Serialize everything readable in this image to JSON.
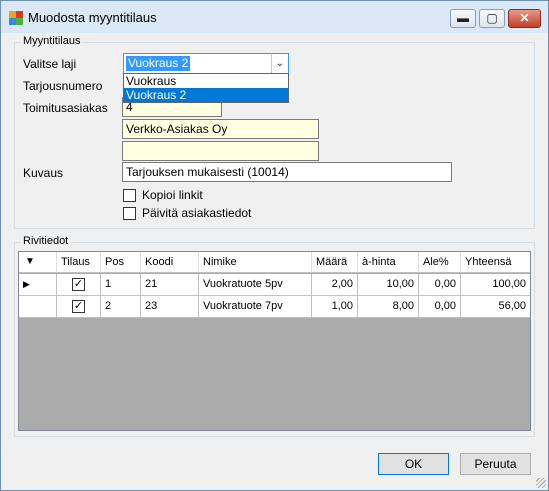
{
  "window": {
    "title": "Muodosta myyntitilaus",
    "minimize_glyph": "▬",
    "maximize_glyph": "▢",
    "close_glyph": "✕"
  },
  "sales_group": {
    "legend": "Myyntitilaus",
    "type_label": "Valitse laji",
    "type_selected": "Vuokraus 2",
    "type_options": [
      "Vuokraus",
      "Vuokraus 2"
    ],
    "offer_label": "Tarjousnumero",
    "customer_label": "Toimitusasiakas",
    "customer_number": "4",
    "customer_name": "Verkko-Asiakas Oy",
    "customer_extra": "",
    "description_label": "Kuvaus",
    "description_value": "Tarjouksen mukaisesti (10014)",
    "copy_links_label": "Kopioi linkit",
    "update_customer_label": "Päivitä asiakastiedot"
  },
  "rows_group": {
    "legend": "Rivitiedot",
    "columns": [
      "Tilaus",
      "Pos",
      "Koodi",
      "Nimike",
      "Määrä",
      "à-hinta",
      "Ale%",
      "Yhteensä"
    ],
    "rows": [
      {
        "pos": "1",
        "code": "21",
        "name": "Vuokratuote 5pv",
        "qty": "2,00",
        "price": "10,00",
        "discount": "0,00",
        "total": "100,00"
      },
      {
        "pos": "2",
        "code": "23",
        "name": "Vuokratuote 7pv",
        "qty": "1,00",
        "price": "8,00",
        "discount": "0,00",
        "total": "56,00"
      }
    ]
  },
  "buttons": {
    "ok": "OK",
    "cancel": "Peruuta"
  },
  "colors": {
    "accent": "#3399ff",
    "selection": "#0078d7",
    "highlight_field": "#ffffe1"
  }
}
